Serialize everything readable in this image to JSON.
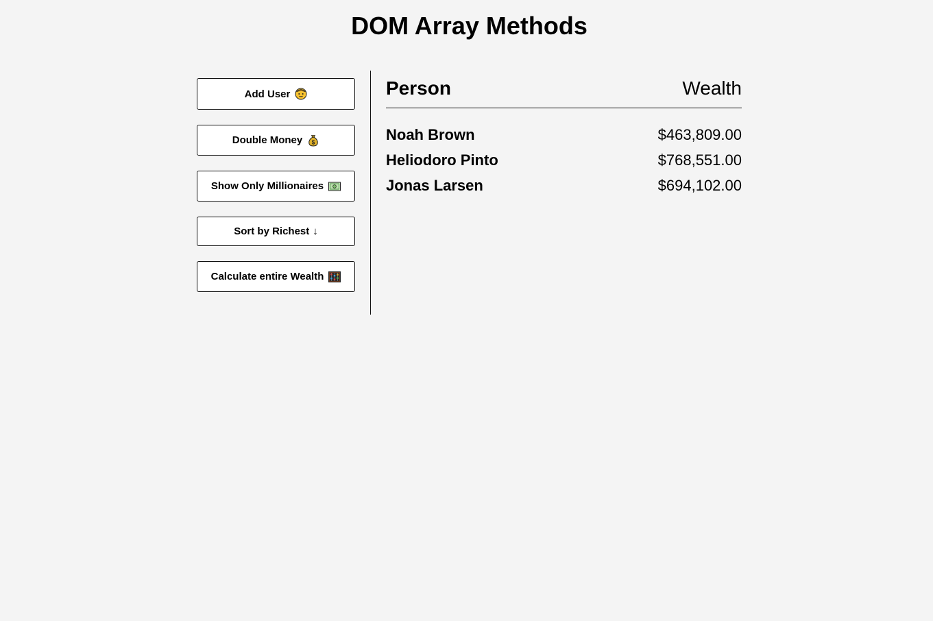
{
  "page": {
    "title": "DOM Array Methods"
  },
  "buttons": {
    "add_user": {
      "label": "Add User",
      "icon": "person-face-icon"
    },
    "double_money": {
      "label": "Double Money",
      "icon": "money-bag-icon"
    },
    "show_millionaires": {
      "label": "Show Only Millionaires",
      "icon": "dollar-banknote-icon"
    },
    "sort_richest": {
      "label": "Sort by Richest",
      "arrow": "↓"
    },
    "calculate_wealth": {
      "label": "Calculate entire Wealth",
      "icon": "abacus-icon"
    }
  },
  "table": {
    "header_person": "Person",
    "header_wealth": "Wealth",
    "rows": [
      {
        "name": "Noah Brown",
        "wealth": "$463,809.00"
      },
      {
        "name": "Heliodoro Pinto",
        "wealth": "$768,551.00"
      },
      {
        "name": "Jonas Larsen",
        "wealth": "$694,102.00"
      }
    ]
  },
  "colors": {
    "background": "#f4f4f4",
    "button_background": "#ffffff",
    "border": "#111111",
    "text": "#000000"
  }
}
